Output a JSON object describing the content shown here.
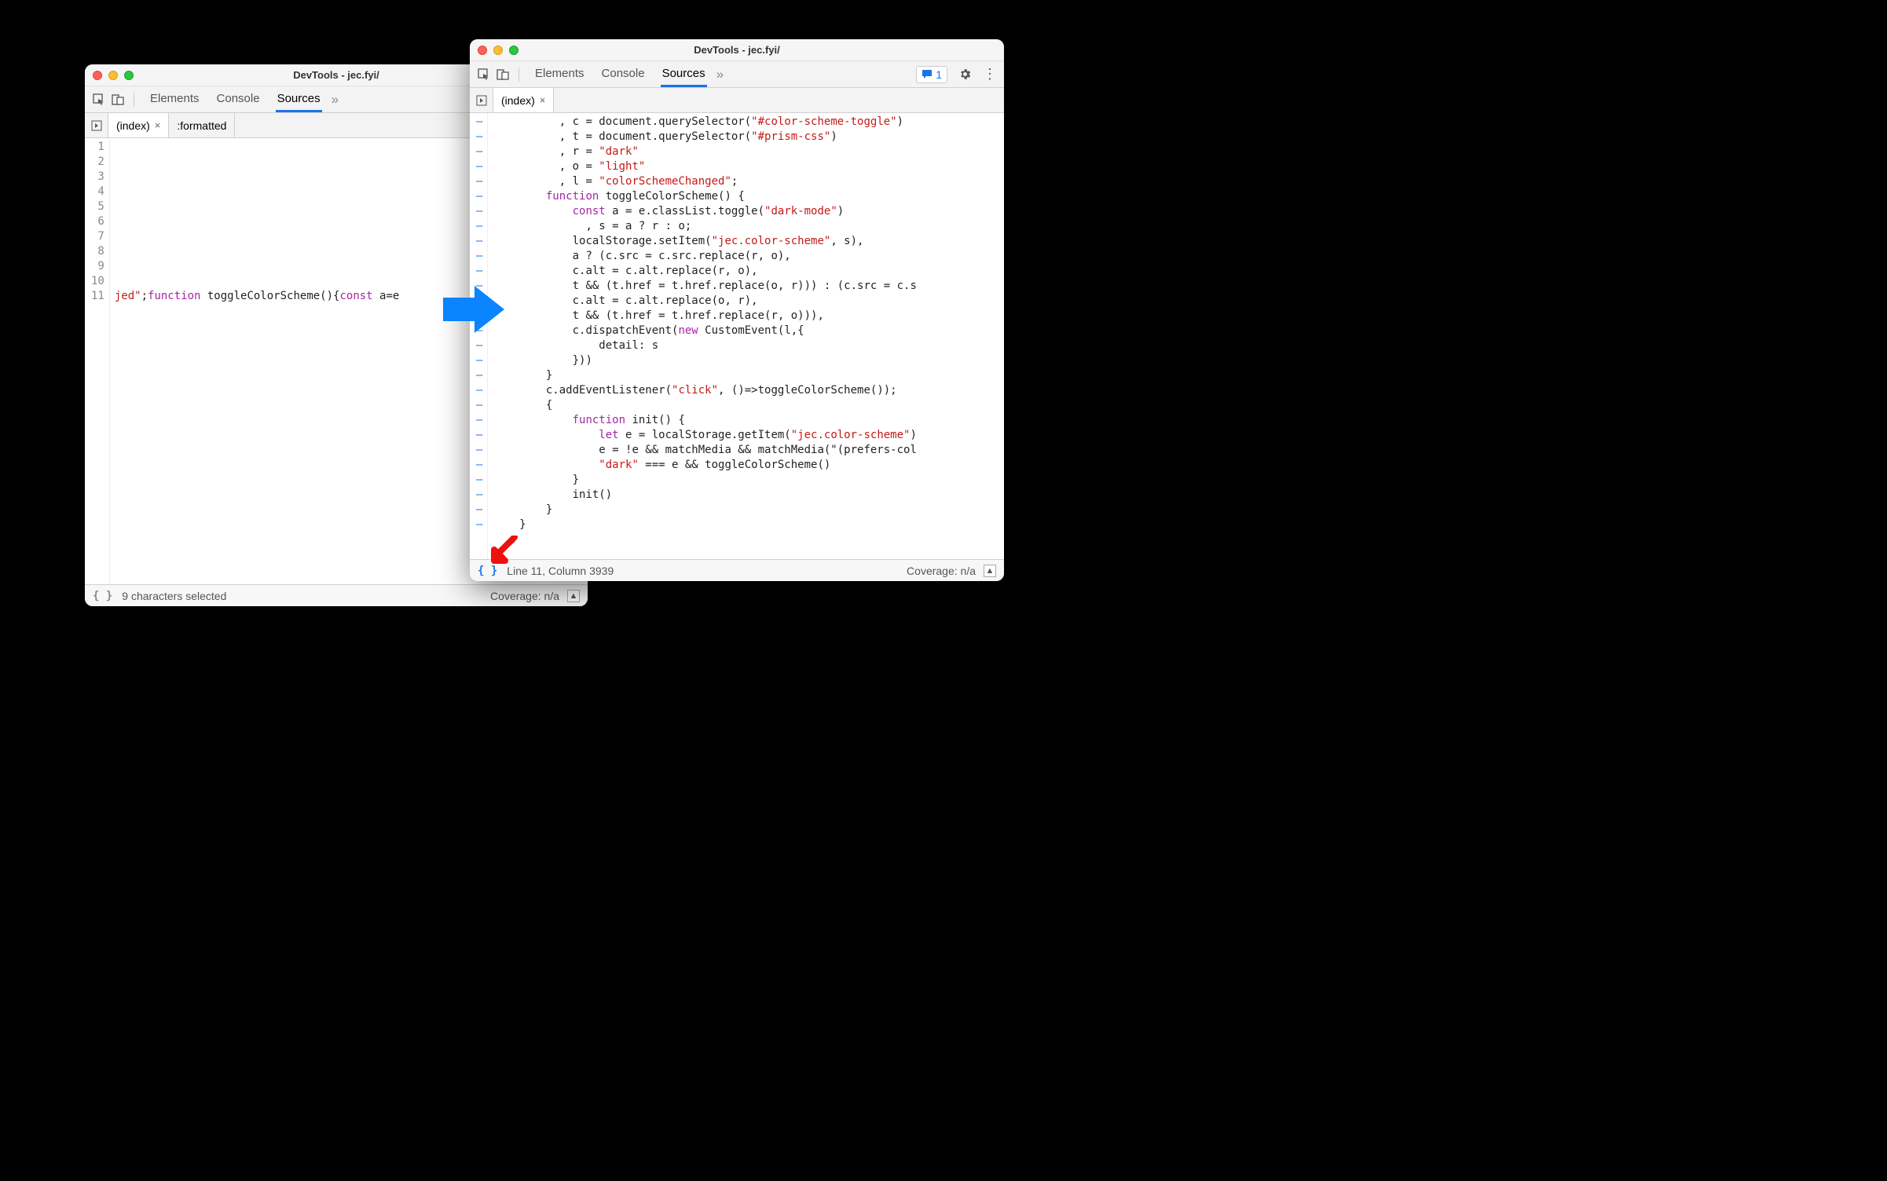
{
  "left": {
    "title": "DevTools - jec.fyi/",
    "tabs": {
      "elements": "Elements",
      "console": "Console",
      "sources": "Sources"
    },
    "sourceTab": "(index)",
    "extraTab": ":formatted",
    "gutter": [
      "1",
      "2",
      "3",
      "4",
      "5",
      "6",
      "7",
      "8",
      "9",
      "10",
      "11"
    ],
    "codeLine": "jed\";function toggleColorScheme(){const a=e",
    "status": "9 characters selected",
    "coverage": "Coverage: n/a"
  },
  "right": {
    "title": "DevTools - jec.fyi/",
    "tabs": {
      "elements": "Elements",
      "console": "Console",
      "sources": "Sources"
    },
    "issueCount": "1",
    "sourceTab": "(index)",
    "status": "Line 11, Column 3939",
    "coverage": "Coverage: n/a",
    "code": [
      "          , c = document.querySelector(\"#color-scheme-toggle\")",
      "          , t = document.querySelector(\"#prism-css\")",
      "          , r = \"dark\"",
      "          , o = \"light\"",
      "          , l = \"colorSchemeChanged\";",
      "        function toggleColorScheme() {",
      "            const a = e.classList.toggle(\"dark-mode\")",
      "              , s = a ? r : o;",
      "            localStorage.setItem(\"jec.color-scheme\", s),",
      "            a ? (c.src = c.src.replace(r, o),",
      "            c.alt = c.alt.replace(r, o),",
      "            t && (t.href = t.href.replace(o, r))) : (c.src = c.s",
      "            c.alt = c.alt.replace(o, r),",
      "            t && (t.href = t.href.replace(r, o))),",
      "            c.dispatchEvent(new CustomEvent(l,{",
      "                detail: s",
      "            }))",
      "        }",
      "        c.addEventListener(\"click\", ()=>toggleColorScheme());",
      "        {",
      "            function init() {",
      "                let e = localStorage.getItem(\"jec.color-scheme\")",
      "                e = !e && matchMedia && matchMedia(\"(prefers-col",
      "                \"dark\" === e && toggleColorScheme()",
      "            }",
      "            init()",
      "        }",
      "    }"
    ]
  }
}
